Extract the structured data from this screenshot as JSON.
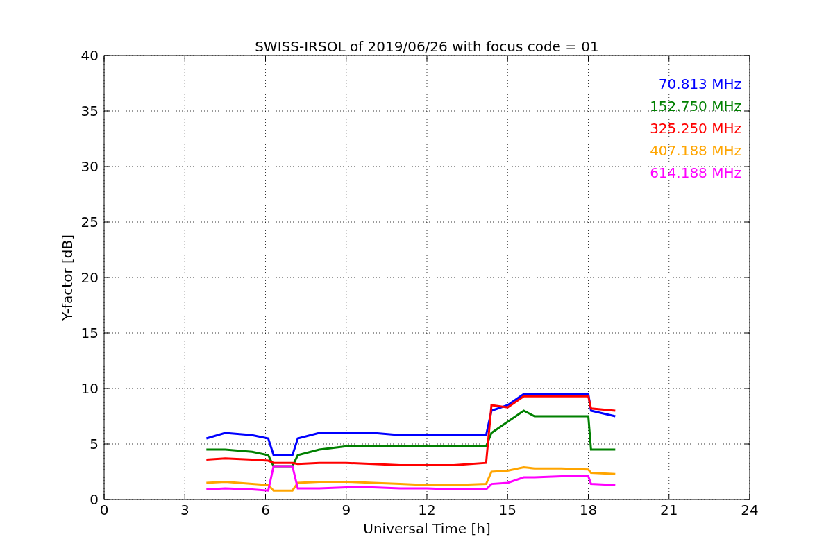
{
  "chart_data": {
    "type": "line",
    "title": "SWISS-IRSOL of 2019/06/26 with focus code = 01",
    "xlabel": "Universal Time [h]",
    "ylabel": "Y-factor [dB]",
    "x": [
      3.8,
      4.5,
      5.5,
      6.1,
      6.3,
      7.0,
      7.2,
      8,
      9,
      10,
      11,
      12,
      13,
      14.2,
      14.4,
      15,
      15.6,
      16,
      17,
      18,
      18.1,
      19
    ],
    "series": [
      {
        "name": "70.813 MHz",
        "color": "#0000ff",
        "values": [
          5.5,
          6,
          5.8,
          5.5,
          4,
          4,
          5.5,
          6,
          6,
          6,
          5.8,
          5.8,
          5.8,
          5.8,
          8,
          8.5,
          9.5,
          9.5,
          9.5,
          9.5,
          8,
          7.5
        ]
      },
      {
        "name": "152.750 MHz",
        "color": "#008000",
        "values": [
          4.5,
          4.5,
          4.3,
          4,
          3,
          3,
          4,
          4.5,
          4.8,
          4.8,
          4.8,
          4.8,
          4.8,
          4.8,
          6,
          7,
          8,
          7.5,
          7.5,
          7.5,
          4.5,
          4.5
        ]
      },
      {
        "name": "325.250 MHz",
        "color": "#ff0000",
        "values": [
          3.6,
          3.7,
          3.6,
          3.5,
          3.3,
          3.3,
          3.2,
          3.3,
          3.3,
          3.2,
          3.1,
          3.1,
          3.1,
          3.3,
          8.5,
          8.3,
          9.3,
          9.3,
          9.3,
          9.3,
          8.2,
          8
        ]
      },
      {
        "name": "407.188 MHz",
        "color": "#ffa500",
        "values": [
          1.5,
          1.6,
          1.4,
          1.3,
          0.8,
          0.8,
          1.5,
          1.6,
          1.6,
          1.5,
          1.4,
          1.3,
          1.3,
          1.4,
          2.5,
          2.6,
          2.9,
          2.8,
          2.8,
          2.7,
          2.4,
          2.3
        ]
      },
      {
        "name": "614.188 MHz",
        "color": "#ff00ff",
        "values": [
          0.9,
          1,
          0.9,
          0.8,
          3,
          3,
          1,
          1,
          1.1,
          1.1,
          1,
          1,
          0.9,
          0.9,
          1.4,
          1.5,
          2,
          2,
          2.1,
          2.1,
          1.4,
          1.3
        ]
      }
    ],
    "grid": true,
    "xlim": [
      0,
      24
    ],
    "ylim": [
      0,
      40
    ],
    "xticks": [
      0,
      3,
      6,
      9,
      12,
      15,
      18,
      21,
      24
    ],
    "yticks": [
      0,
      5,
      10,
      15,
      20,
      25,
      30,
      35,
      40
    ]
  }
}
